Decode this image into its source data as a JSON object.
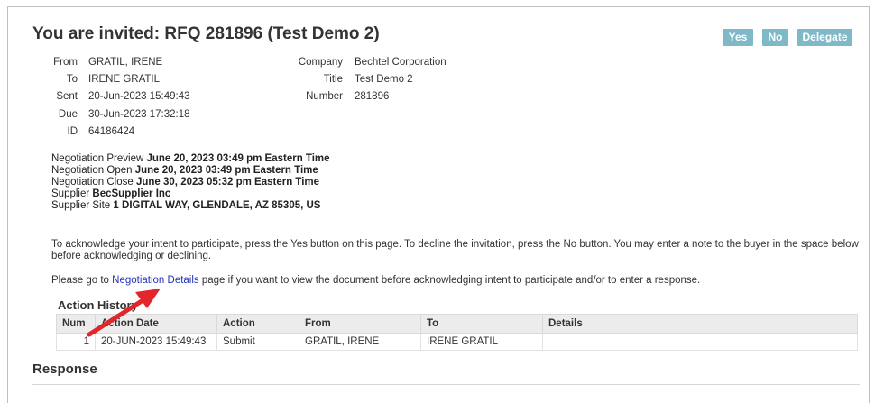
{
  "header": {
    "title": "You are invited: RFQ 281896 (Test Demo 2)",
    "yes_label": "Yes",
    "no_label": "No",
    "delegate_label": "Delegate"
  },
  "details_left": [
    {
      "label": "From",
      "value": "GRATIL, IRENE"
    },
    {
      "label": "To",
      "value": "IRENE GRATIL"
    },
    {
      "label": "Sent",
      "value": "20-Jun-2023 15:49:43"
    },
    {
      "label": "Due",
      "value": "30-Jun-2023 17:32:18"
    },
    {
      "label": "ID",
      "value": "64186424"
    }
  ],
  "details_right": [
    {
      "label": "Company",
      "value": "Bechtel Corporation"
    },
    {
      "label": "Title",
      "value": "Test Demo 2"
    },
    {
      "label": "Number",
      "value": "281896"
    }
  ],
  "negotiation": [
    {
      "label": "Negotiation Preview",
      "value": "June 20, 2023 03:49 pm Eastern Time"
    },
    {
      "label": "Negotiation Open",
      "value": "June 20, 2023 03:49 pm Eastern Time"
    },
    {
      "label": "Negotiation Close",
      "value": "June 30, 2023 05:32 pm Eastern Time"
    },
    {
      "label": "Supplier",
      "value": "BecSupplier Inc"
    },
    {
      "label": "Supplier Site",
      "value": "1 DIGITAL WAY, GLENDALE, AZ 85305, US"
    }
  ],
  "instructions": {
    "acknowledge": "To acknowledge your intent to participate, press the Yes button on this page. To decline the invitation, press the No button. You may enter a note to the buyer in the space below before acknowledging or declining.",
    "goto_prefix": "Please go to",
    "goto_link": "Negotiation Details",
    "goto_suffix": "page if you want to view the document before acknowledging intent to participate and/or to enter a response."
  },
  "action_history": {
    "title": "Action History",
    "columns": [
      "Num",
      "Action Date",
      "Action",
      "From",
      "To",
      "Details"
    ],
    "rows": [
      {
        "num": "1",
        "date": "20-JUN-2023 15:49:43",
        "action": "Submit",
        "from": "GRATIL, IRENE",
        "to": "IRENE GRATIL",
        "details": ""
      }
    ]
  },
  "response": {
    "title": "Response"
  },
  "colors": {
    "button_bg": "#7fb8c6",
    "link": "#2233bb",
    "annotation_arrow": "#e3262b"
  }
}
